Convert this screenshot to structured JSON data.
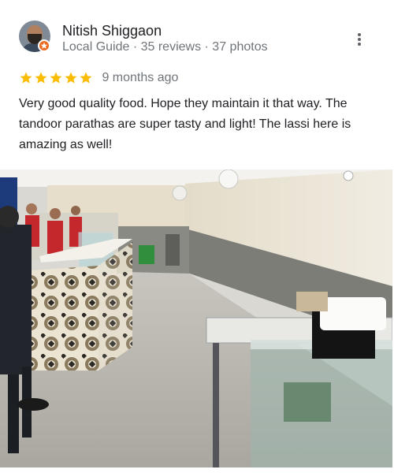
{
  "reviewer": {
    "name": "Nitish Shiggaon",
    "meta": "Local Guide · 35 reviews · 37 photos",
    "avatar_icon": "user-avatar",
    "badge_icon": "local-guide-star-icon",
    "badge_color": "#ea6b1f"
  },
  "menu": {
    "icon": "more-vert-icon"
  },
  "rating": {
    "value": 5,
    "max": 5,
    "star_color": "#fbbc04",
    "date": "9 months ago"
  },
  "review": {
    "text": "Very good quality food. Hope they maintain it that way. The tandoor parathas are super tasty and light! The lassi here is amazing as well!"
  },
  "photo": {
    "subject": "restaurant-interior-photo"
  }
}
